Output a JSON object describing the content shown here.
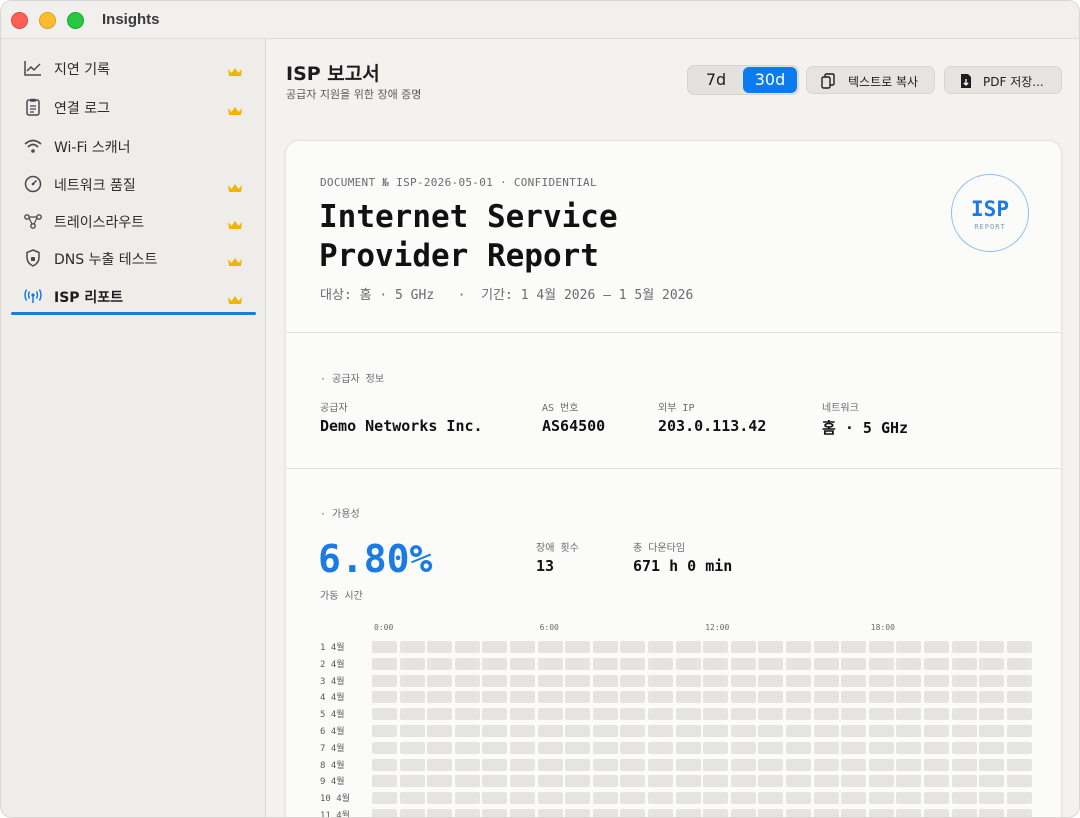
{
  "window": {
    "title": "Insights"
  },
  "sidebar": {
    "items": [
      {
        "label": "지연 기록",
        "icon": "chart-line-icon",
        "premium": true
      },
      {
        "label": "연결 로그",
        "icon": "clipboard-icon",
        "premium": true
      },
      {
        "label": "Wi-Fi 스캐너",
        "icon": "wifi-icon",
        "premium": false
      },
      {
        "label": "네트워크 품질",
        "icon": "gauge-icon",
        "premium": true
      },
      {
        "label": "트레이스라우트",
        "icon": "route-nodes-icon",
        "premium": true
      },
      {
        "label": "DNS 누출 테스트",
        "icon": "shield-icon",
        "premium": true
      },
      {
        "label": "ISP 리포트",
        "icon": "antenna-icon",
        "premium": true,
        "active": true
      }
    ]
  },
  "header": {
    "title": "ISP 보고서",
    "subtitle": "공급자 지원을 위한 장애 증명",
    "range_options": [
      "7d",
      "30d"
    ],
    "selected_range": "30d",
    "copy_label": "텍스트로 복사",
    "pdf_label": "PDF 저장..."
  },
  "document": {
    "number_line": "DOCUMENT № ISP-2026-05-01 · CONFIDENTIAL",
    "title_line1": "Internet Service",
    "title_line2": "Provider Report",
    "meta_target": "대상: 홈 · 5 GHz",
    "meta_period": "기간: 1 4월 2026 — 1 5월 2026",
    "stamp_main": "ISP",
    "stamp_sub": "REPORT",
    "provider_section": {
      "label": "· 공급자 정보",
      "fields": [
        {
          "label": "공급자",
          "value": "Demo Networks Inc."
        },
        {
          "label": "AS 번호",
          "value": "AS64500"
        },
        {
          "label": "외부 IP",
          "value": "203.0.113.42"
        },
        {
          "label": "네트워크",
          "value": "홈 · 5 GHz"
        }
      ]
    },
    "availability": {
      "label": "· 가용성",
      "uptime_value": "6.80%",
      "uptime_caption": "가동 시간",
      "outage_count_label": "장애 횟수",
      "outage_count_value": "13",
      "downtime_label": "총 다운타임",
      "downtime_value": "671 h 0 min"
    },
    "heatmap": {
      "hour_labels": [
        "0:00",
        "6:00",
        "12:00",
        "18:00"
      ],
      "day_labels": [
        "1 4월",
        "2 4월",
        "3 4월",
        "4 4월",
        "5 4월",
        "6 4월",
        "7 4월",
        "8 4월",
        "9 4월",
        "10 4월",
        "11 4월"
      ],
      "cell_color": "#e5e4e1"
    }
  },
  "colors": {
    "accent": "#0a7cf0",
    "premium_crown": "#f2b400",
    "uptime": "#1a7be4"
  }
}
